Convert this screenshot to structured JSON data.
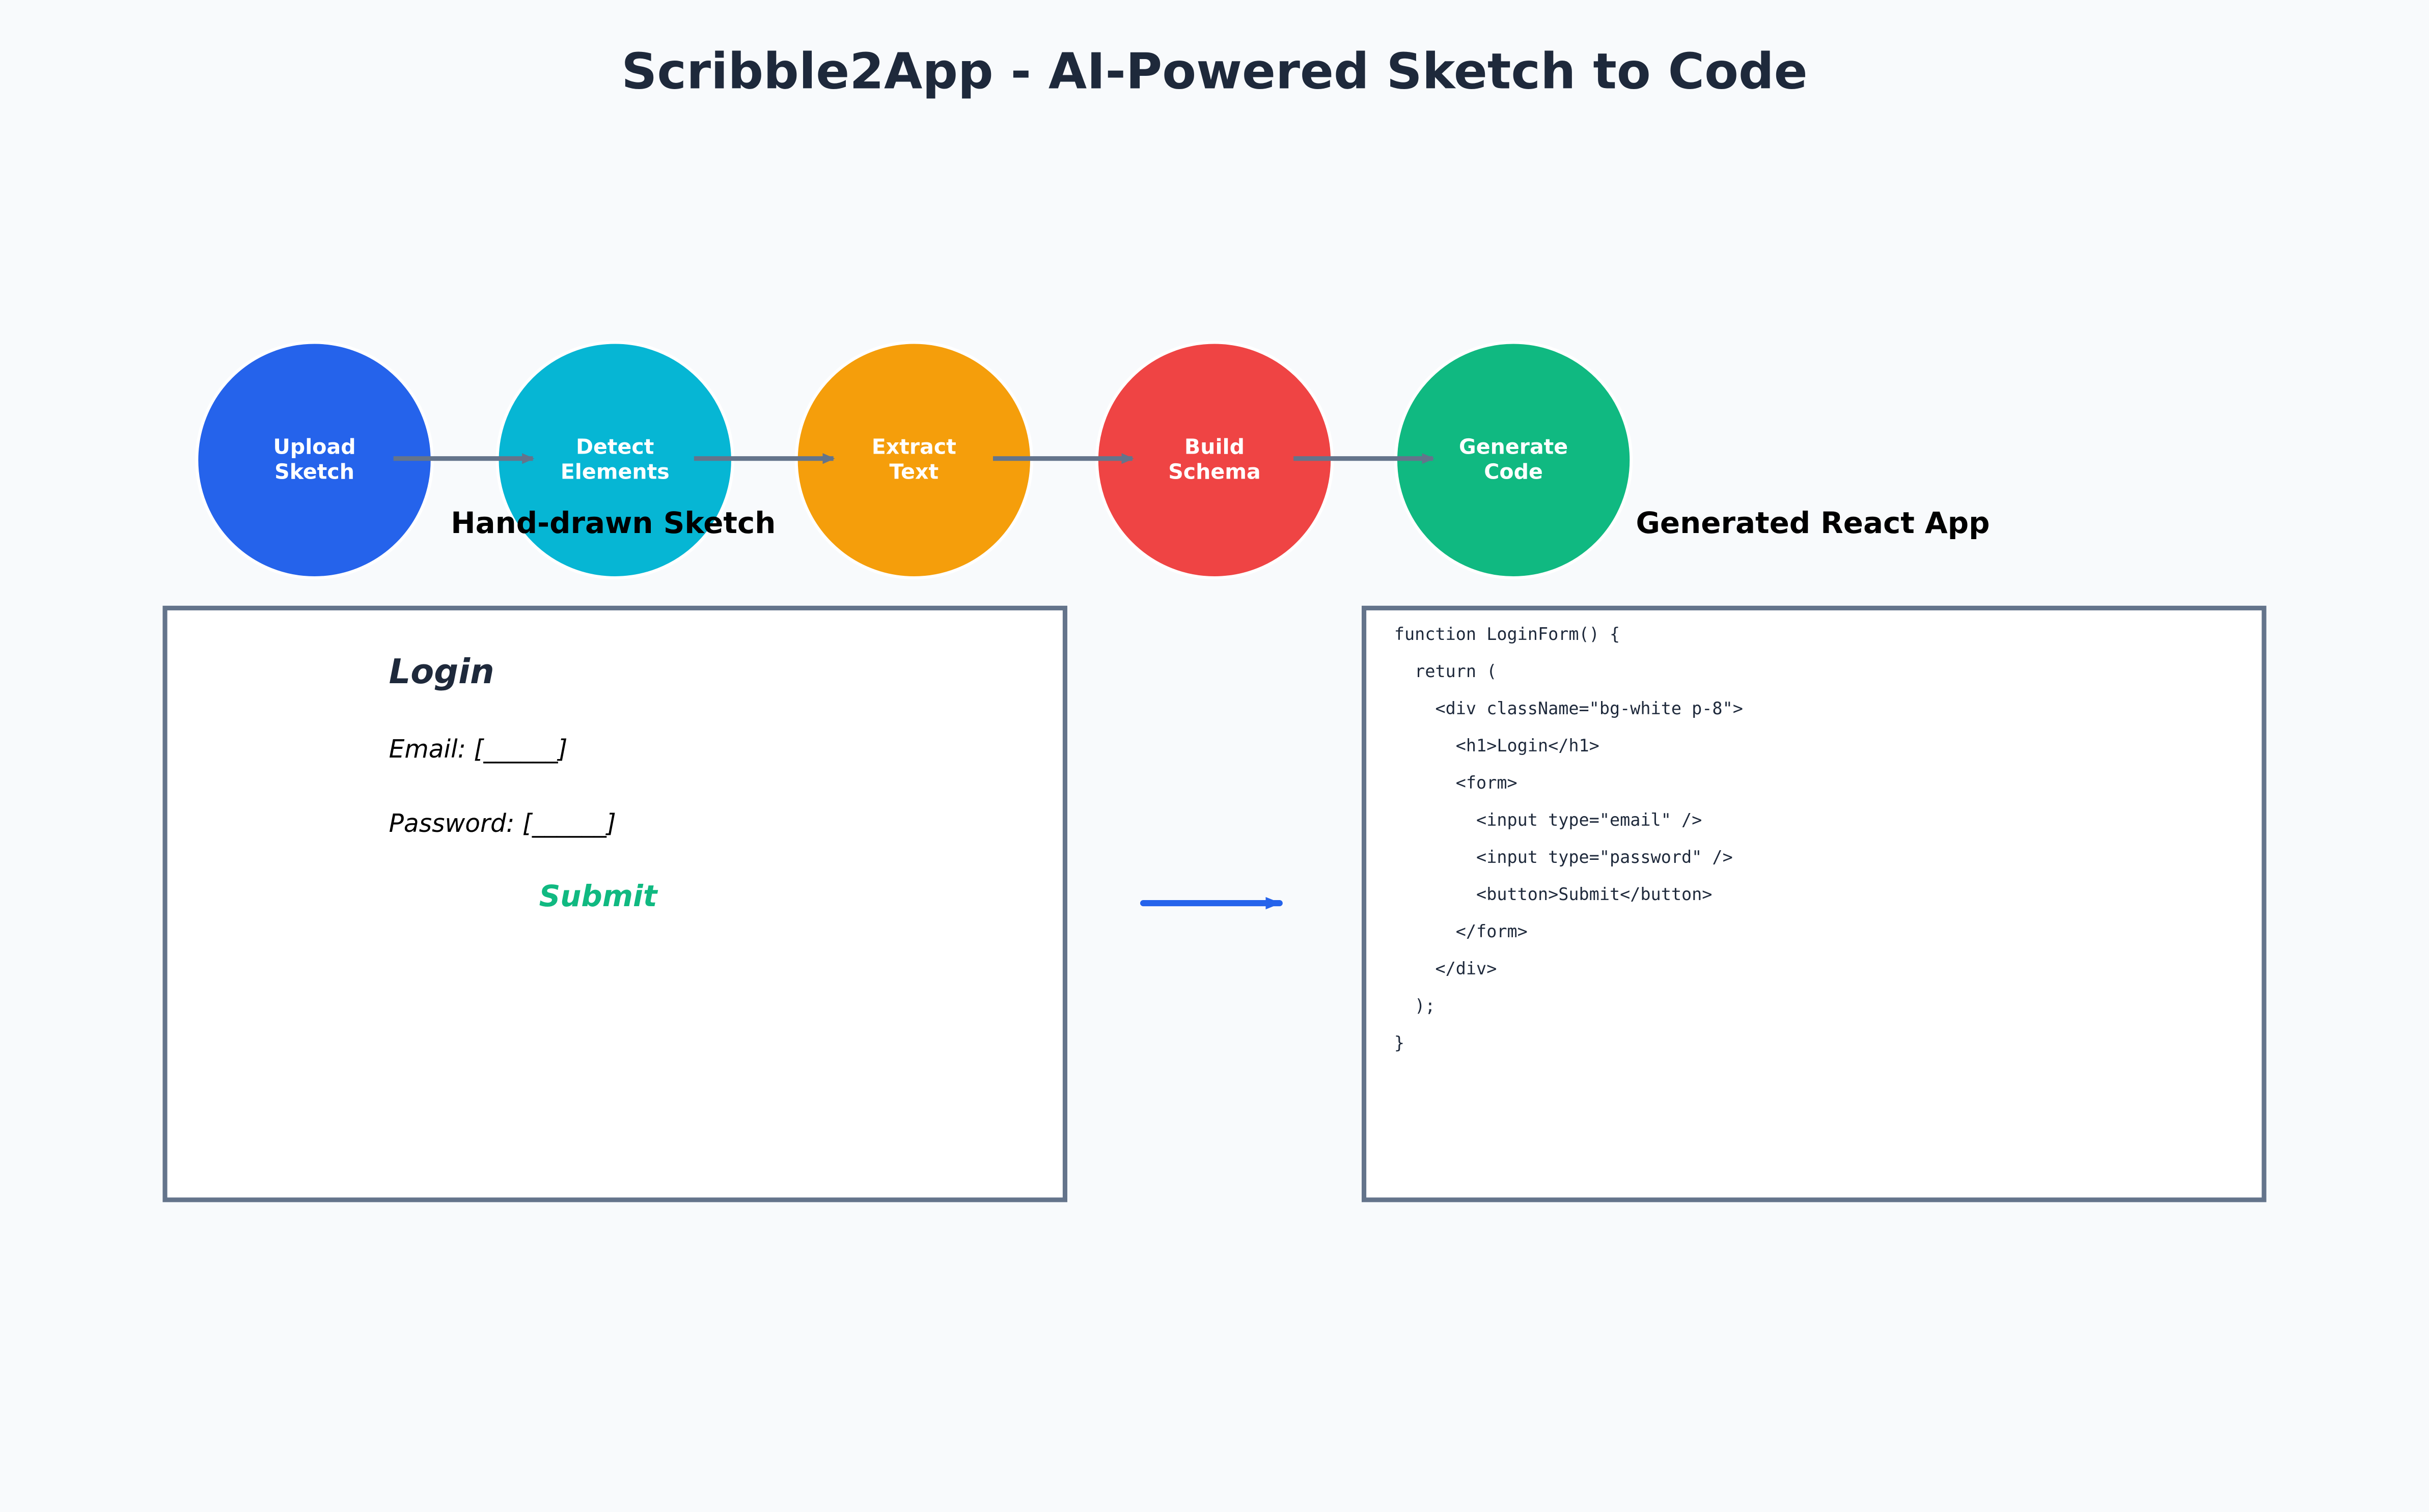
{
  "title": "Scribble2App - AI-Powered Sketch to Code",
  "colors": {
    "step1": "#2563eb",
    "step2": "#06b6d4",
    "step3": "#f59e0b",
    "step4": "#ef4444",
    "step5": "#10b981",
    "connector": "#64748b",
    "main_arrow": "#2563eb",
    "submit": "#10b981"
  },
  "steps": [
    {
      "label": "Upload\nSketch"
    },
    {
      "label": "Detect\nElements"
    },
    {
      "label": "Extract\nText"
    },
    {
      "label": "Build\nSchema"
    },
    {
      "label": "Generate\nCode"
    }
  ],
  "sketch": {
    "section_title": "Hand-drawn Sketch",
    "heading": "Login",
    "email_line": "Email: [______]",
    "password_line": "Password: [______]",
    "submit": "Submit"
  },
  "code": {
    "section_title": "Generated React App",
    "lines": [
      "function LoginForm() {",
      "  return (",
      "    <div className=\"bg-white p-8\">",
      "      <h1>Login</h1>",
      "      <form>",
      "        <input type=\"email\" />",
      "        <input type=\"password\" />",
      "        <button>Submit</button>",
      "      </form>",
      "    </div>",
      "  );",
      "}"
    ]
  }
}
